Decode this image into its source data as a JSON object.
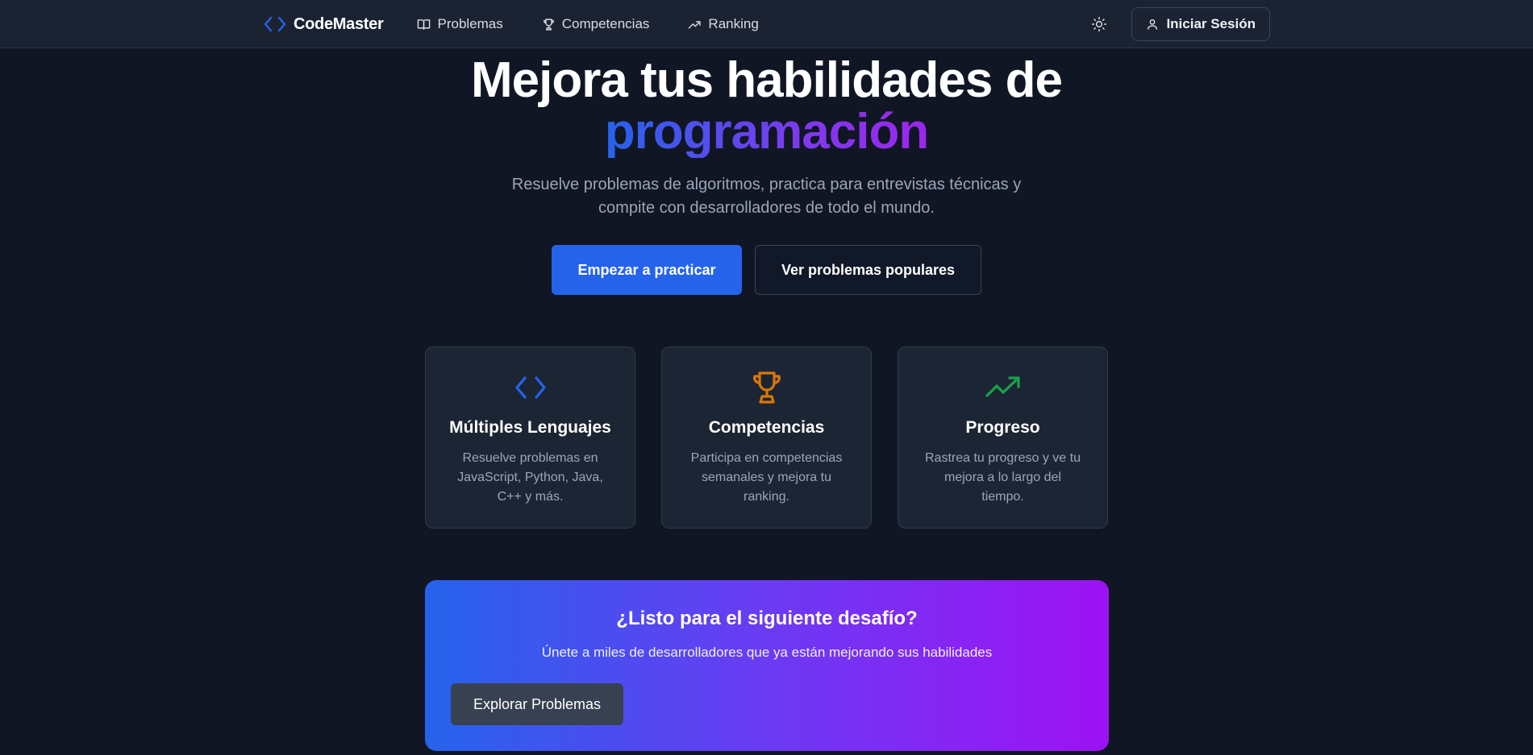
{
  "nav": {
    "brand": "CodeMaster",
    "links": [
      {
        "label": "Problemas",
        "icon": "book-icon"
      },
      {
        "label": "Competencias",
        "icon": "trophy-icon"
      },
      {
        "label": "Ranking",
        "icon": "trending-up-icon"
      }
    ],
    "theme_icon": "sun-icon",
    "login_label": "Iniciar Sesión"
  },
  "hero": {
    "title_line1": "Mejora tus habilidades de",
    "title_accent": "programación",
    "subtitle": "Resuelve problemas de algoritmos, practica para entrevistas técnicas y compite con desarrolladores de todo el mundo.",
    "primary_cta": "Empezar a practicar",
    "secondary_cta": "Ver problemas populares"
  },
  "features": [
    {
      "icon": "code-icon",
      "color": "#2563eb",
      "title": "Múltiples Lenguajes",
      "description": "Resuelve problemas en JavaScript, Python, Java, C++ y más."
    },
    {
      "icon": "trophy-icon",
      "color": "#d97706",
      "title": "Competencias",
      "description": "Participa en competencias semanales y mejora tu ranking."
    },
    {
      "icon": "trending-up-icon",
      "color": "#16a34a",
      "title": "Progreso",
      "description": "Rastrea tu progreso y ve tu mejora a lo largo del tiempo."
    }
  ],
  "banner": {
    "title": "¿Listo para el siguiente desafío?",
    "subtitle": "Únete a miles de desarrolladores que ya están mejorando sus habilidades",
    "button": "Explorar Problemas"
  },
  "colors": {
    "background": "#101624",
    "navbar": "#1b2333",
    "accent_blue": "#2563eb",
    "accent_purple": "#9d12f3"
  }
}
